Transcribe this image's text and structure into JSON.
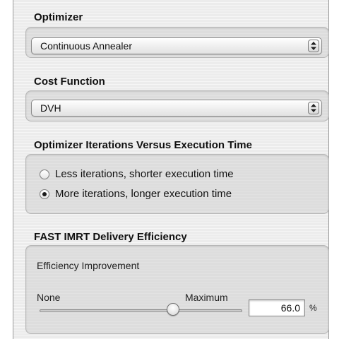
{
  "optimizer": {
    "title": "Optimizer",
    "selected": "Continuous Annealer"
  },
  "cost_function": {
    "title": "Cost Function",
    "selected": "DVH"
  },
  "iterations": {
    "title": "Optimizer Iterations Versus Execution Time",
    "options": [
      {
        "label": "Less iterations, shorter execution time",
        "selected": false
      },
      {
        "label": "More iterations, longer execution time",
        "selected": true
      }
    ]
  },
  "delivery": {
    "title": "FAST IMRT Delivery Efficiency",
    "subtitle": "Efficiency Improvement",
    "min_label": "None",
    "max_label": "Maximum",
    "value": "66.0",
    "value_fraction": 0.66,
    "unit": "%"
  },
  "icons": {
    "popup_arrows": "up-down-arrows-icon"
  }
}
